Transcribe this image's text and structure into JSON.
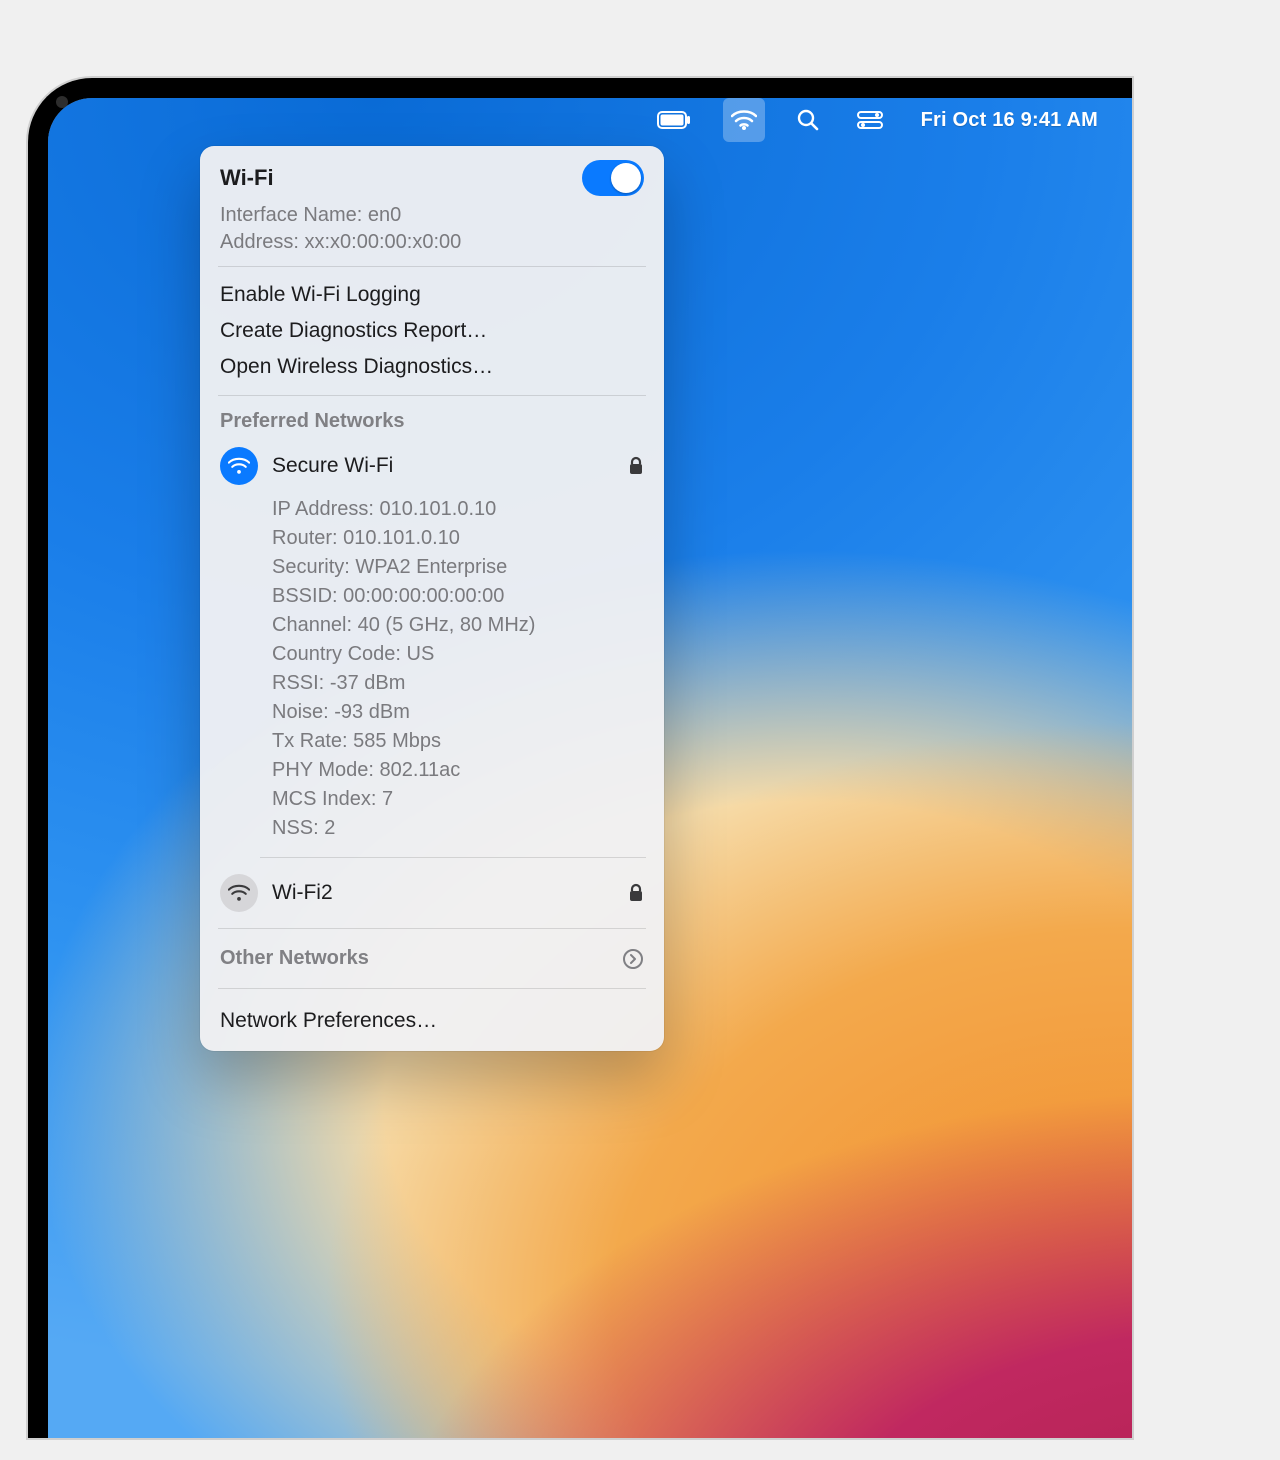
{
  "menubar": {
    "datetime": "Fri Oct 16  9:41 AM"
  },
  "panel": {
    "title": "Wi-Fi",
    "toggle_on": true,
    "interface_label": "Interface Name:",
    "interface_value": "en0",
    "address_label": "Address:",
    "address_value": "xx:x0:00:00:x0:00",
    "actions": {
      "enable_logging": "Enable Wi-Fi Logging",
      "create_diag": "Create Diagnostics Report…",
      "open_diag": "Open Wireless Diagnostics…"
    },
    "preferred_label": "Preferred Networks",
    "network_connected": {
      "name": "Secure Wi-Fi",
      "locked": true,
      "details": [
        {
          "k": "IP Address:",
          "v": "010.101.0.10"
        },
        {
          "k": "Router:",
          "v": "010.101.0.10"
        },
        {
          "k": "Security:",
          "v": "WPA2 Enterprise"
        },
        {
          "k": "BSSID:",
          "v": "00:00:00:00:00:00"
        },
        {
          "k": "Channel:",
          "v": "40 (5 GHz, 80 MHz)"
        },
        {
          "k": "Country Code:",
          "v": "US"
        },
        {
          "k": "RSSI:",
          "v": "-37 dBm"
        },
        {
          "k": "Noise:",
          "v": "-93 dBm"
        },
        {
          "k": "Tx Rate:",
          "v": "585 Mbps"
        },
        {
          "k": "PHY Mode:",
          "v": "802.11ac"
        },
        {
          "k": "MCS Index:",
          "v": "7"
        },
        {
          "k": "NSS:",
          "v": "2"
        }
      ]
    },
    "network_other_known": {
      "name": "Wi-Fi2",
      "locked": true
    },
    "other_networks_label": "Other Networks",
    "network_prefs": "Network Preferences…"
  }
}
